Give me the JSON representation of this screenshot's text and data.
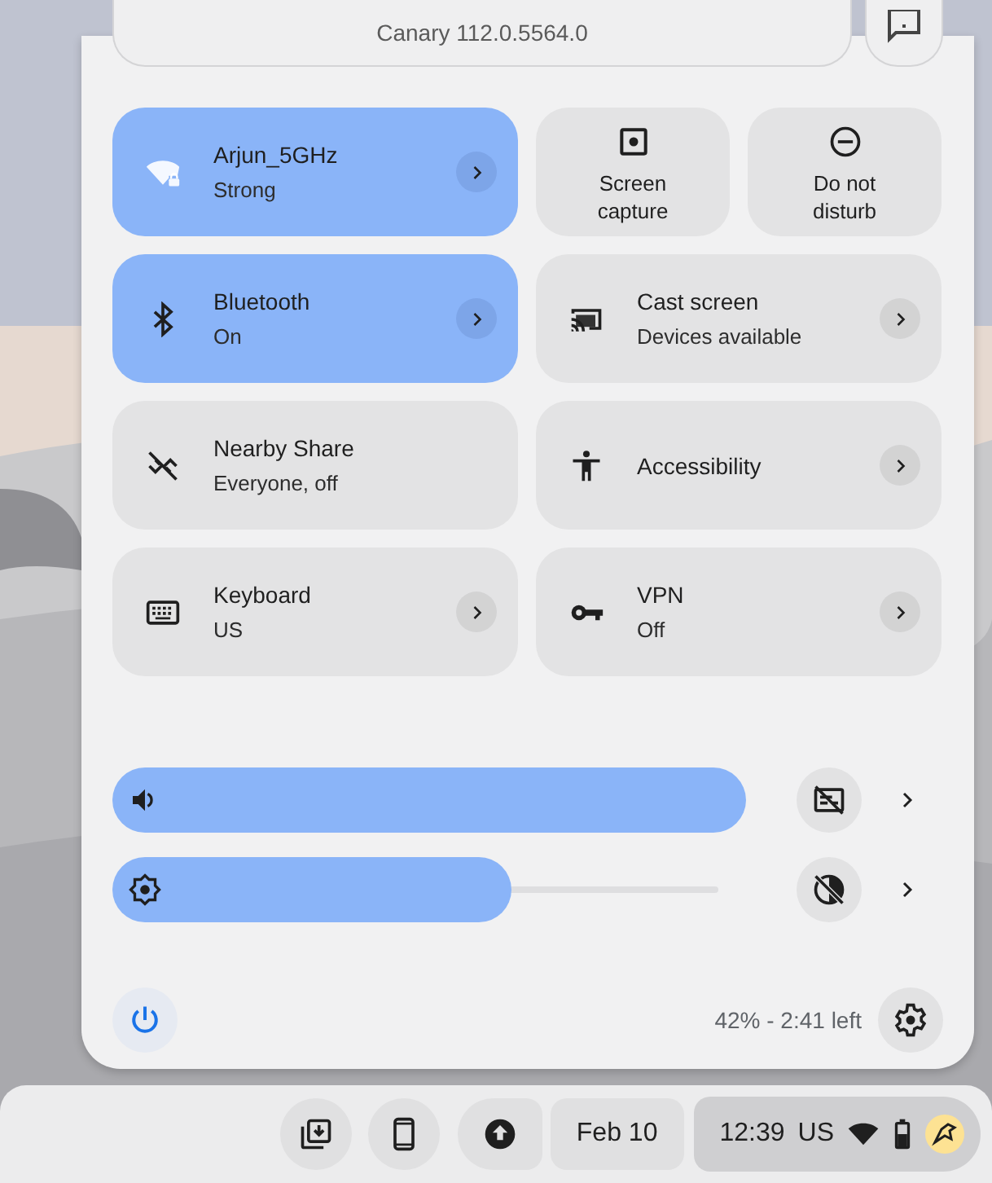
{
  "version": {
    "label": "Canary 112.0.5564.0"
  },
  "tiles": [
    {
      "kind": "wide",
      "title": "Arjun_5GHz",
      "subtitle": "Strong",
      "on": true,
      "detail": true
    },
    {
      "kind": "small",
      "title": "Screen capture",
      "on": false
    },
    {
      "kind": "small",
      "title": "Do not disturb",
      "on": false
    },
    {
      "kind": "wide",
      "title": "Bluetooth",
      "subtitle": "On",
      "on": true,
      "detail": true
    },
    {
      "kind": "wide",
      "title": "Cast screen",
      "subtitle": "Devices available",
      "on": false,
      "detail": true
    },
    {
      "kind": "wide",
      "title": "Nearby Share",
      "subtitle": "Everyone, off",
      "on": false,
      "detail": false
    },
    {
      "kind": "wide",
      "title": "Accessibility",
      "on": false,
      "detail": true
    },
    {
      "kind": "wide",
      "title": "Keyboard",
      "subtitle": "US",
      "on": false,
      "detail": true
    },
    {
      "kind": "wide",
      "title": "VPN",
      "subtitle": "Off",
      "on": false,
      "detail": true
    }
  ],
  "sliders": [
    {
      "level": 1.0
    },
    {
      "level": 0.63
    }
  ],
  "battery": "42% - 2:41 left",
  "shelf": {
    "date": "Feb 10",
    "time": "12:39",
    "ime": "US"
  }
}
